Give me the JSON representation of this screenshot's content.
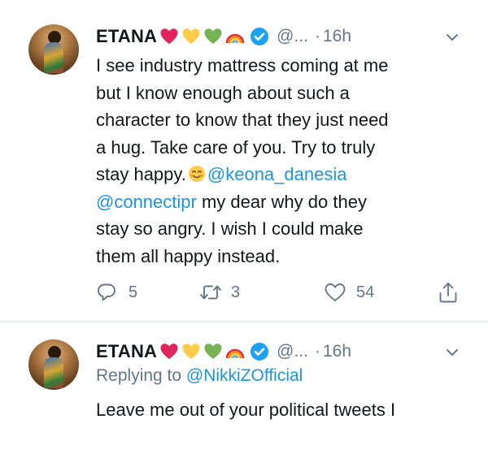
{
  "tweets": [
    {
      "author": "ETANA",
      "handle": "@...",
      "separator": "·",
      "time": "16h",
      "body_lines": [
        "I see industry mattress coming at me",
        "but I know enough about such a",
        "character  to know that they just need",
        "a hug. Take care of you. Try to truly"
      ],
      "line5_prefix": "stay happy.",
      "mention_1": "@keona_danesia",
      "mention_2": "@connectipr",
      "line6_rest": " my dear why do they",
      "body_tail": [
        "stay so angry. I wish I could make",
        "them all happy instead."
      ],
      "replies": "5",
      "retweets": "3",
      "likes": "54"
    },
    {
      "author": "ETANA",
      "handle": "@...",
      "separator": "·",
      "time": "16h",
      "replying_prefix": "Replying to ",
      "replying_to": "@NikkiZOfficial",
      "body": "Leave me out of your political tweets I"
    }
  ],
  "icons": {
    "emojis": [
      "red-heart-icon",
      "yellow-heart-icon",
      "green-heart-icon",
      "rainbow-icon"
    ],
    "verified": "verified-badge-icon",
    "smile": "smiling-face-icon",
    "actions": [
      "reply-icon",
      "retweet-icon",
      "like-icon",
      "share-icon"
    ],
    "menu": "chevron-down-icon"
  },
  "colors": {
    "link": "#1b95e0",
    "secondary_text": "#657786",
    "verified": "#1da1f2",
    "divider": "#e6ecf0"
  }
}
